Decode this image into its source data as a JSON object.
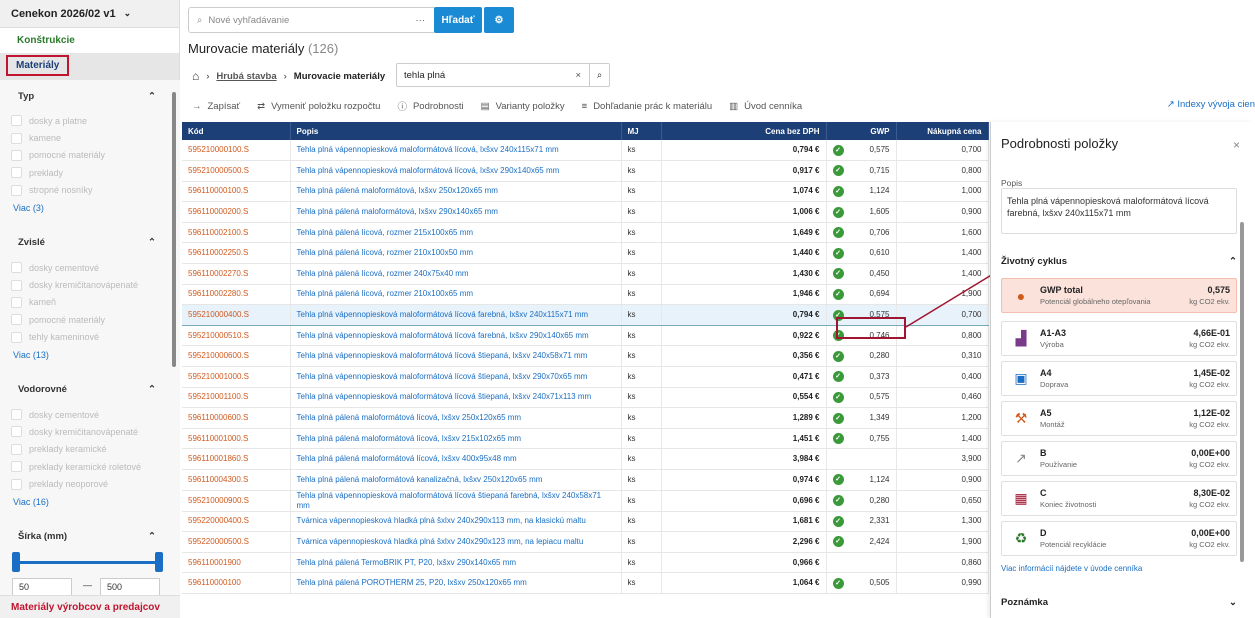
{
  "sidebar": {
    "header": "Cenekon 2026/02 v1",
    "section_konstrukcie": "Konštrukcie",
    "section_materialy": "Materiály",
    "groups": [
      {
        "title": "Typ",
        "items": [
          "dosky a platne",
          "kamene",
          "pomocné materiály",
          "preklady",
          "stropné nosníky"
        ],
        "more": "Viac (3)"
      },
      {
        "title": "Zvislé",
        "items": [
          "dosky cementové",
          "dosky kremičitanovápenaté",
          "kameň",
          "pomocné materiály",
          "tehly kameninové"
        ],
        "more": "Viac (13)"
      },
      {
        "title": "Vodorovné",
        "items": [
          "dosky cementové",
          "dosky kremičitanovápenaté",
          "preklady keramické",
          "preklady keramické roletové",
          "preklady neoporové"
        ],
        "more": "Viac (16)"
      }
    ],
    "width_title": "Šírka (mm)",
    "width_min": "50",
    "width_sep": "—",
    "width_max": "500",
    "footer": "Materiály výrobcov a predajcov"
  },
  "search": {
    "placeholder": "Nové vyhľadávanie",
    "button": "Hľadať"
  },
  "page": {
    "title": "Murovacie materiály",
    "count": "(126)"
  },
  "breadcrumb": {
    "link": "Hrubá stavba",
    "current": "Murovacie materiály",
    "filter": "tehla plná"
  },
  "toolbar": {
    "zapisat": "Zapísať",
    "vymenit": "Vymeniť položku rozpočtu",
    "podrobnosti": "Podrobnosti",
    "varianty": "Varianty položky",
    "dohladanie": "Dohľadanie prác k materiálu",
    "uvod": "Úvod cenníka",
    "indexy": "Indexy vývoja cien"
  },
  "table": {
    "headers": [
      "Kód",
      "Popis",
      "MJ",
      "Cena bez DPH",
      "GWP",
      "Nákupná cena"
    ],
    "rows": [
      [
        "595210000100.S",
        "Tehla plná vápennopiesková maloformátová lícová, lxšxv 240x115x71 mm",
        "ks",
        "0,794 €",
        "0,575",
        "0,700"
      ],
      [
        "595210000500.S",
        "Tehla plná vápennopiesková maloformátová lícová, lxšxv 290x140x65 mm",
        "ks",
        "0,917 €",
        "0,715",
        "0,800"
      ],
      [
        "596110000100.S",
        "Tehla plná pálená maloformátová, lxšxv 250x120x65 mm",
        "ks",
        "1,074 €",
        "1,124",
        "1,000"
      ],
      [
        "596110000200.S",
        "Tehla plná pálená maloformátová, lxšxv 290x140x65 mm",
        "ks",
        "1,006 €",
        "1,605",
        "0,900"
      ],
      [
        "596110002100.S",
        "Tehla plná pálená lícová, rozmer 215x100x65 mm",
        "ks",
        "1,649 €",
        "0,706",
        "1,600"
      ],
      [
        "596110002250.S",
        "Tehla plná pálená lícová, rozmer 210x100x50 mm",
        "ks",
        "1,440 €",
        "0,610",
        "1,400"
      ],
      [
        "596110002270.S",
        "Tehla plná pálená lícová, rozmer 240x75x40 mm",
        "ks",
        "1,430 €",
        "0,450",
        "1,400"
      ],
      [
        "596110002280.S",
        "Tehla plná pálená lícová, rozmer 210x100x65 mm",
        "ks",
        "1,946 €",
        "0,694",
        "1,900"
      ],
      [
        "595210000400.S",
        "Tehla plná vápennopiesková maloformátová lícová farebná, lxšxv 240x115x71 mm",
        "ks",
        "0,794 €",
        "0,575",
        "0,700"
      ],
      [
        "595210000510.S",
        "Tehla plná vápennopiesková maloformátová lícová farebná, lxšxv 290x140x65 mm",
        "ks",
        "0,922 €",
        "0,746",
        "0,800"
      ],
      [
        "595210000600.S",
        "Tehla plná vápennopiesková maloformátová lícová štiepaná, lxšxv 240x58x71 mm",
        "ks",
        "0,356 €",
        "0,280",
        "0,310"
      ],
      [
        "595210001000.S",
        "Tehla plná vápennopiesková maloformátová lícová štiepaná, lxšxv 290x70x65 mm",
        "ks",
        "0,471 €",
        "0,373",
        "0,400"
      ],
      [
        "595210001100.S",
        "Tehla plná vápennopiesková maloformátová lícová štiepaná, lxšxv 240x71x113 mm",
        "ks",
        "0,554 €",
        "0,575",
        "0,460"
      ],
      [
        "596110000600.S",
        "Tehla plná pálená maloformátová lícová, lxšxv 250x120x65 mm",
        "ks",
        "1,289 €",
        "1,349",
        "1,200"
      ],
      [
        "596110001000.S",
        "Tehla plná pálená maloformátová lícová, lxšxv 215x102x65 mm",
        "ks",
        "1,451 €",
        "0,755",
        "1,400"
      ],
      [
        "596110001860.S",
        "Tehla plná pálená maloformátová lícová, lxšxv 400x95x48 mm",
        "ks",
        "3,984 €",
        "",
        "3,900"
      ],
      [
        "596110004300.S",
        "Tehla plná pálená maloformátová kanalizačná, lxšxv 250x120x65 mm",
        "ks",
        "0,974 €",
        "1,124",
        "0,900"
      ],
      [
        "595210000900.S",
        "Tehla plná vápennopiesková maloformátová lícová štiepaná farebná, lxšxv 240x58x71 mm",
        "ks",
        "0,696 €",
        "0,280",
        "0,650"
      ],
      [
        "595220000400.S",
        "Tvárnica vápennopiesková hladká plná šxlxv 240x290x113 mm, na klasickú maltu",
        "ks",
        "1,681 €",
        "2,331",
        "1,300"
      ],
      [
        "595220000500.S",
        "Tvárnica vápennopiesková hladká plná šxlxv 240x290x123 mm, na lepiacu maltu",
        "ks",
        "2,296 €",
        "2,424",
        "1,900"
      ],
      [
        "596110001900",
        "Tehla plná pálená TermoBRIK PT, P20, lxšxv 290x140x65 mm",
        "ks",
        "0,966 €",
        "",
        "0,860"
      ],
      [
        "596110000100",
        "Tehla plná pálená POROTHERM 25, P20, lxšxv 250x120x65 mm",
        "ks",
        "1,064 €",
        "0,505",
        "0,990"
      ]
    ]
  },
  "panel": {
    "title": "Podrobnosti položky",
    "popis_label": "Popis",
    "popis": "Tehla plná vápennopiesková maloformátová lícová farebná, lxšxv 240x115x71 mm",
    "cycle_title": "Životný cyklus",
    "cards": [
      {
        "icon": "globe",
        "t1": "GWP total",
        "t2": "Potenciál globálneho otepľovania",
        "v1": "0,575",
        "v2": "kg CO2 ekv."
      },
      {
        "icon": "factory",
        "t1": "A1-A3",
        "t2": "Výroba",
        "v1": "4,66E-01",
        "v2": "kg CO2 ekv."
      },
      {
        "icon": "truck",
        "t1": "A4",
        "t2": "Doprava",
        "v1": "1,45E-02",
        "v2": "kg CO2 ekv."
      },
      {
        "icon": "crane",
        "t1": "A5",
        "t2": "Montáž",
        "v1": "1,12E-02",
        "v2": "kg CO2 ekv."
      },
      {
        "icon": "trend",
        "t1": "B",
        "t2": "Používanie",
        "v1": "0,00E+00",
        "v2": "kg CO2 ekv."
      },
      {
        "icon": "trash",
        "t1": "C",
        "t2": "Koniec životnosti",
        "v1": "8,30E-02",
        "v2": "kg CO2 ekv."
      },
      {
        "icon": "recycle",
        "t1": "D",
        "t2": "Potenciál recyklácie",
        "v1": "0,00E+00",
        "v2": "kg CO2 ekv."
      }
    ],
    "more": "Viac informácií nájdete v úvode cenníka",
    "note": "Poznámka"
  }
}
